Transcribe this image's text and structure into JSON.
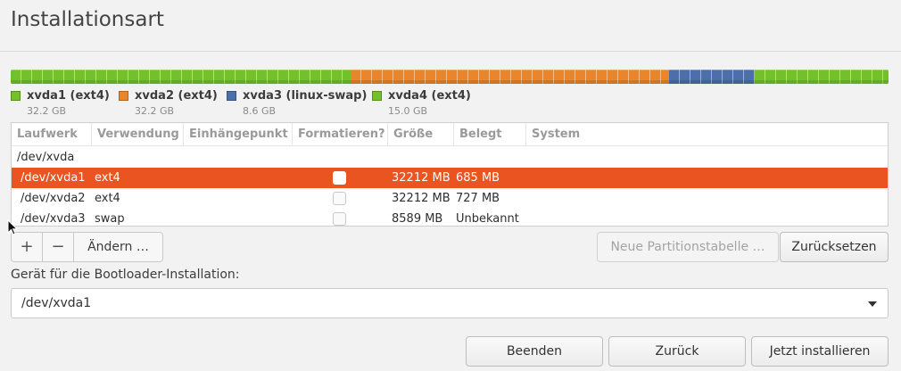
{
  "window": {
    "title": "Installationsart"
  },
  "partition_bar": {
    "segments": [
      {
        "name": "xvda1",
        "fraction": 0.3875,
        "color": "#73c12a"
      },
      {
        "name": "xvda2",
        "fraction": 0.3625,
        "color": "#e9852b"
      },
      {
        "name": "xvda3",
        "fraction": 0.0975,
        "color": "#4b6fab"
      },
      {
        "name": "xvda4",
        "fraction": 0.1525,
        "color": "#73c12a"
      }
    ]
  },
  "legend": [
    {
      "label": "xvda1 (ext4)",
      "size": "32.2 GB",
      "color": "#73c12a"
    },
    {
      "label": "xvda2 (ext4)",
      "size": "32.2 GB",
      "color": "#e9852b"
    },
    {
      "label": "xvda3 (linux-swap)",
      "size": "8.6 GB",
      "color": "#4b6fab"
    },
    {
      "label": "xvda4 (ext4)",
      "size": "15.0 GB",
      "color": "#73c12a"
    }
  ],
  "table": {
    "columns": [
      "Laufwerk",
      "Verwendung",
      "Einhängepunkt",
      "Formatieren?",
      "Größe",
      "Belegt",
      "System"
    ],
    "device": "/dev/xvda",
    "rows": [
      {
        "laufwerk": "/dev/xvda1",
        "verwendung": "ext4",
        "einhaengepunkt": "",
        "formatieren": false,
        "groesse": "32212 MB",
        "belegt": "685 MB",
        "system": "",
        "selected": true
      },
      {
        "laufwerk": "/dev/xvda2",
        "verwendung": "ext4",
        "einhaengepunkt": "",
        "formatieren": false,
        "groesse": "32212 MB",
        "belegt": "727 MB",
        "system": "",
        "selected": false
      },
      {
        "laufwerk": "/dev/xvda3",
        "verwendung": "swap",
        "einhaengepunkt": "",
        "formatieren": false,
        "groesse": "8589 MB",
        "belegt": "Unbekannt",
        "system": "",
        "selected": false
      }
    ]
  },
  "toolbar": {
    "add_symbol": "+",
    "remove_symbol": "−",
    "change_label": "Ändern …",
    "new_table_label": "Neue Partitionstabelle …",
    "reset_label": "Zurücksetzen"
  },
  "bootloader": {
    "label": "Gerät für die Bootloader-Installation:",
    "selected": "/dev/xvda1"
  },
  "footer": {
    "quit_label": "Beenden",
    "back_label": "Zurück",
    "install_label": "Jetzt installieren"
  },
  "colors": {
    "accent": "#e95420"
  }
}
